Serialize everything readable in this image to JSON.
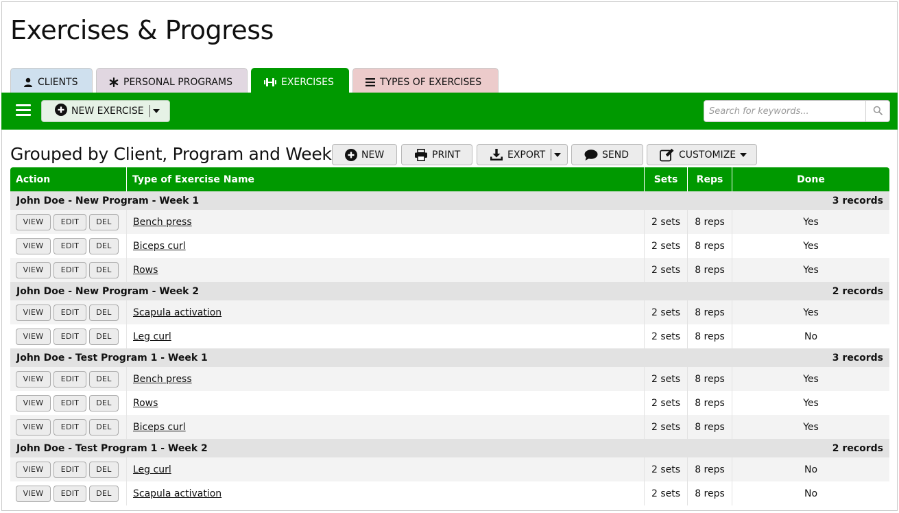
{
  "page": {
    "title": "Exercises & Progress",
    "accent_color": "#009900"
  },
  "tabs": [
    {
      "label": "CLIENTS",
      "icon": "user-icon",
      "color": "#cfe0ee"
    },
    {
      "label": "PERSONAL PROGRAMS",
      "icon": "asterisk-icon",
      "color": "#e1d7e1"
    },
    {
      "label": "EXERCISES",
      "icon": "dumbbell-icon",
      "color": "#009900",
      "active": true
    },
    {
      "label": "TYPES OF EXERCISES",
      "icon": "list-icon",
      "color": "#eccbcb"
    }
  ],
  "toolbar": {
    "new_label": "NEW EXERCISE",
    "search_placeholder": "Search for keywords..."
  },
  "grid": {
    "group_title": "Grouped by Client, Program and Week",
    "actions": {
      "new": "NEW",
      "print": "PRINT",
      "export": "EXPORT",
      "send": "SEND",
      "customize": "CUSTOMIZE"
    },
    "columns": {
      "action": "Action",
      "name": "Type of Exercise Name",
      "sets": "Sets",
      "reps": "Reps",
      "done": "Done"
    },
    "row_buttons": {
      "view": "VIEW",
      "edit": "EDIT",
      "del": "DEL"
    },
    "groups": [
      {
        "title": "John Doe - New Program - Week 1",
        "count": "3 records",
        "rows": [
          {
            "name": "Bench press",
            "sets": "2 sets",
            "reps": "8 reps",
            "done": "Yes"
          },
          {
            "name": "Biceps curl",
            "sets": "2 sets",
            "reps": "8 reps",
            "done": "Yes"
          },
          {
            "name": "Rows",
            "sets": "2 sets",
            "reps": "8 reps",
            "done": "Yes"
          }
        ]
      },
      {
        "title": "John Doe - New Program - Week 2",
        "count": "2 records",
        "rows": [
          {
            "name": "Scapula activation",
            "sets": "2 sets",
            "reps": "8 reps",
            "done": "Yes"
          },
          {
            "name": "Leg curl",
            "sets": "2 sets",
            "reps": "8 reps",
            "done": "No"
          }
        ]
      },
      {
        "title": "John Doe - Test Program 1 - Week 1",
        "count": "3 records",
        "rows": [
          {
            "name": "Bench press",
            "sets": "2 sets",
            "reps": "8 reps",
            "done": "Yes"
          },
          {
            "name": "Rows",
            "sets": "2 sets",
            "reps": "8 reps",
            "done": "Yes"
          },
          {
            "name": "Biceps curl",
            "sets": "2 sets",
            "reps": "8 reps",
            "done": "Yes"
          }
        ]
      },
      {
        "title": "John Doe - Test Program 1 - Week 2",
        "count": "2 records",
        "rows": [
          {
            "name": "Leg curl",
            "sets": "2 sets",
            "reps": "8 reps",
            "done": "No"
          },
          {
            "name": "Scapula activation",
            "sets": "2 sets",
            "reps": "8 reps",
            "done": "No"
          }
        ]
      }
    ]
  }
}
